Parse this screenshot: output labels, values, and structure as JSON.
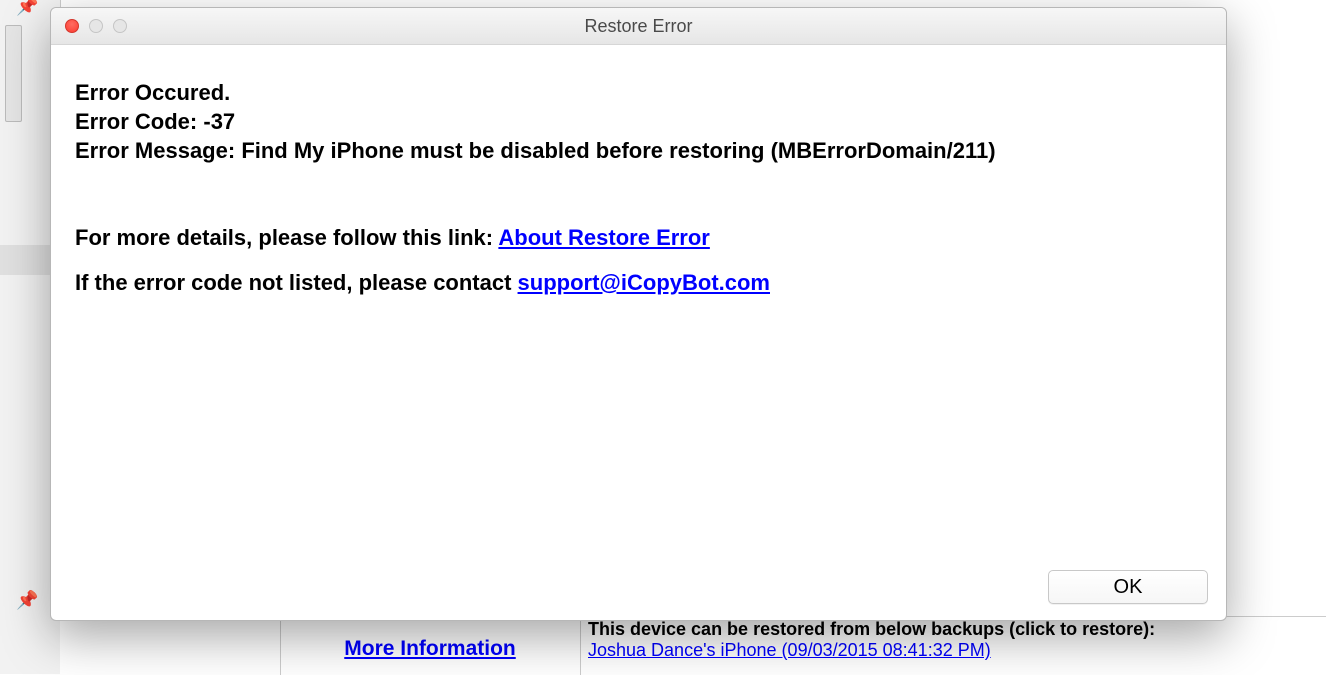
{
  "dialog": {
    "title": "Restore Error",
    "error_heading": "Error Occured.",
    "error_code_label": "Error Code:",
    "error_code_value": "-37",
    "error_msg_label": "Error Message:",
    "error_msg_value": "Find My iPhone must be disabled before restoring (MBErrorDomain/211)",
    "details_prefix": "For more details, please follow this link: ",
    "details_link": "About Restore Error",
    "contact_prefix": "If the error code not listed, please contact ",
    "contact_link": "support@iCopyBot.com",
    "ok_label": "OK"
  },
  "background": {
    "more_info_link": "More Information",
    "restore_desc": "This device can be restored from below backups (click to restore):",
    "backup_link": "Joshua Dance's iPhone (09/03/2015 08:41:32 PM)"
  }
}
